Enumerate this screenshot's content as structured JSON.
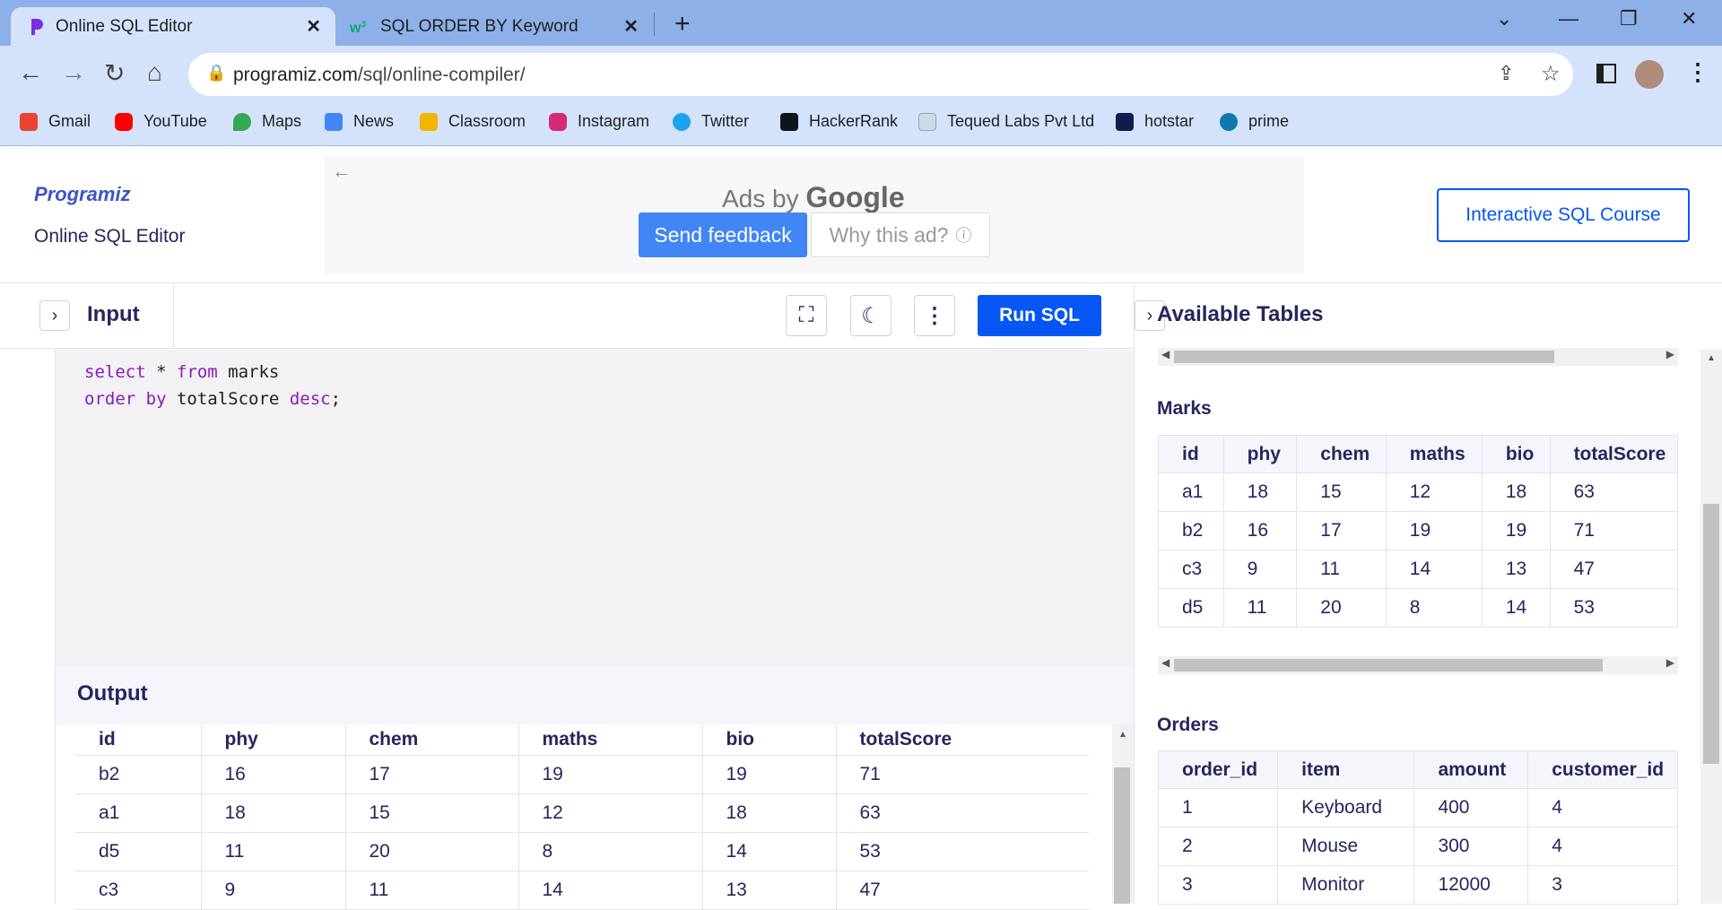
{
  "browser": {
    "tabs": [
      {
        "title": "Online SQL Editor",
        "icon": "programiz-favicon"
      },
      {
        "title": "SQL ORDER BY Keyword",
        "icon": "w3schools-favicon"
      }
    ],
    "url_host": "programiz.com",
    "url_path": "/sql/online-compiler/",
    "bookmarks": [
      "Gmail",
      "YouTube",
      "Maps",
      "News",
      "Classroom",
      "Instagram",
      "Twitter",
      "HackerRank",
      "Tequed Labs Pvt Ltd",
      "hotstar",
      "prime"
    ]
  },
  "header": {
    "logo": "Programiz",
    "subtitle": "Online SQL Editor",
    "ad_label": "Ads by",
    "ad_brand": "Google",
    "send_feedback": "Send feedback",
    "why_ad": "Why this ad?",
    "course_button": "Interactive SQL Course"
  },
  "input": {
    "label": "Input",
    "run_label": "Run SQL",
    "code_line1_kw1": "select",
    "code_line1_mid": " * ",
    "code_line1_kw2": "from",
    "code_line1_rest": " marks",
    "code_line2_kw1": "order",
    "code_line2_kw2": "by",
    "code_line2_mid": " totalScore ",
    "code_line2_kw3": "desc",
    "code_line2_end": ";"
  },
  "output": {
    "label": "Output",
    "columns": [
      "id",
      "phy",
      "chem",
      "maths",
      "bio",
      "totalScore"
    ],
    "rows": [
      [
        "b2",
        "16",
        "17",
        "19",
        "19",
        "71"
      ],
      [
        "a1",
        "18",
        "15",
        "12",
        "18",
        "63"
      ],
      [
        "d5",
        "11",
        "20",
        "8",
        "14",
        "53"
      ],
      [
        "c3",
        "9",
        "11",
        "14",
        "13",
        "47"
      ]
    ]
  },
  "tables_panel": {
    "title": "Available Tables",
    "marks": {
      "name": "Marks",
      "columns": [
        "id",
        "phy",
        "chem",
        "maths",
        "bio",
        "totalScore"
      ],
      "rows": [
        [
          "a1",
          "18",
          "15",
          "12",
          "18",
          "63"
        ],
        [
          "b2",
          "16",
          "17",
          "19",
          "19",
          "71"
        ],
        [
          "c3",
          "9",
          "11",
          "14",
          "13",
          "47"
        ],
        [
          "d5",
          "11",
          "20",
          "8",
          "14",
          "53"
        ]
      ]
    },
    "orders": {
      "name": "Orders",
      "columns": [
        "order_id",
        "item",
        "amount",
        "customer_id"
      ],
      "rows": [
        [
          "1",
          "Keyboard",
          "400",
          "4"
        ],
        [
          "2",
          "Mouse",
          "300",
          "4"
        ],
        [
          "3",
          "Monitor",
          "12000",
          "3"
        ]
      ]
    }
  }
}
